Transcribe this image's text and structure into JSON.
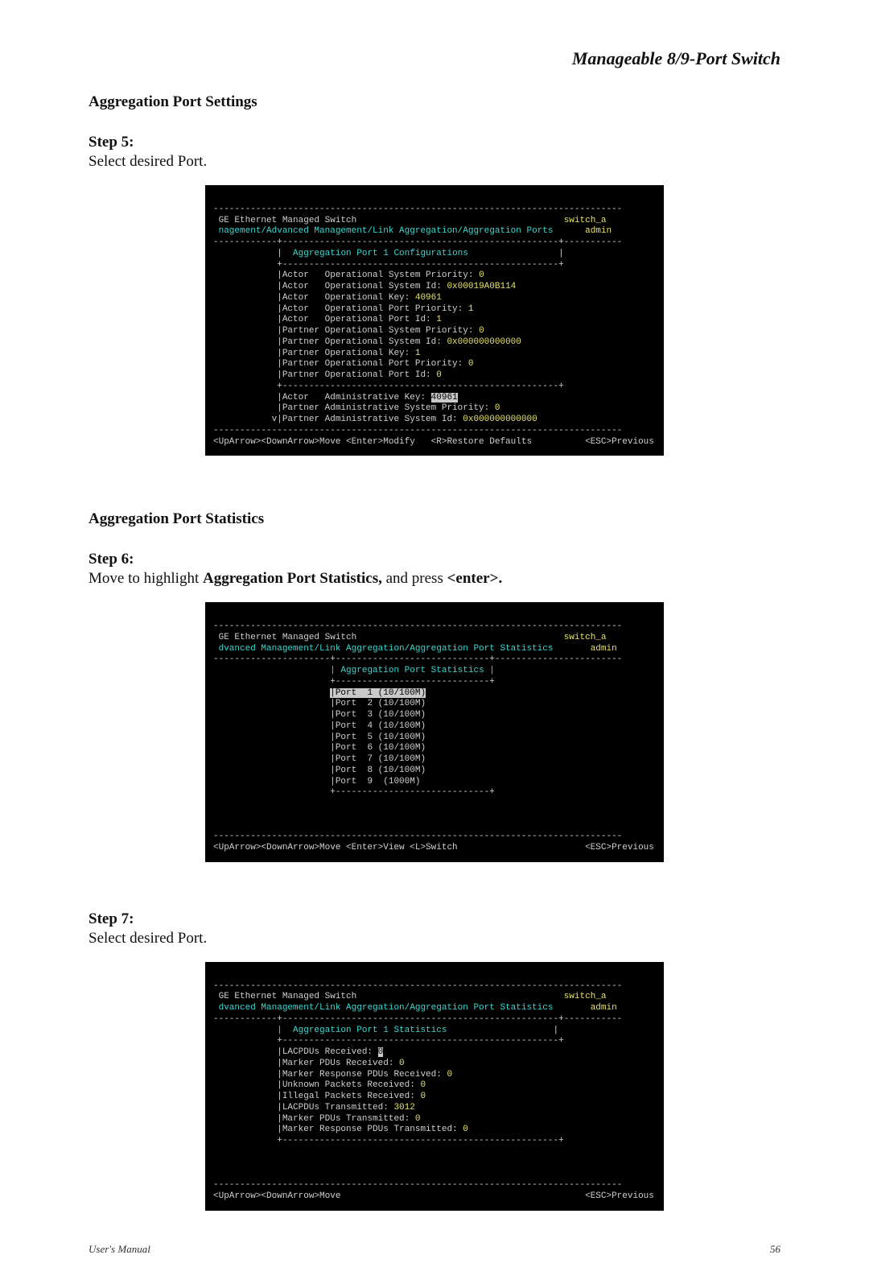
{
  "header": {
    "title": "Manageable 8/9-Port Switch"
  },
  "section1": {
    "title": "Aggregation Port Settings",
    "step_label": "Step 5:",
    "step_body": "Select desired Port."
  },
  "term1": {
    "brand": "GE Ethernet Managed Switch",
    "host": "switch_a",
    "user": "admin",
    "breadcrumb": "nagement/Advanced Management/Link Aggregation/Aggregation Ports",
    "panel_title": "Aggregation Port 1 Configurations",
    "rows": [
      {
        "l": "|Actor   Operational System Priority:",
        "v": " 0"
      },
      {
        "l": "|Actor   Operational System Id:",
        "v": " 0x00019A0B114"
      },
      {
        "l": "|Actor   Operational Key:",
        "v": " 40961"
      },
      {
        "l": "|Actor   Operational Port Priority:",
        "v": " 1"
      },
      {
        "l": "|Actor   Operational Port Id:",
        "v": " 1"
      },
      {
        "l": "|Partner Operational System Priority:",
        "v": " 0"
      },
      {
        "l": "|Partner Operational System Id:",
        "v": " 0x000000000000"
      },
      {
        "l": "|Partner Operational Key:",
        "v": " 1"
      },
      {
        "l": "|Partner Operational Port Priority:",
        "v": " 0"
      },
      {
        "l": "|Partner Operational Port Id:",
        "v": " 0"
      }
    ],
    "adm_actor_l": "|Actor   Administrative Key: ",
    "adm_actor_v": "40961",
    "adm_partner_prio_l": "|Partner Administrative System Priority:",
    "adm_partner_prio_v": " 0",
    "adm_partner_id_l": "v|Partner Administrative System Id:",
    "adm_partner_id_v": " 0x000000000000",
    "help": "<UpArrow><DownArrow>Move <Enter>Modify   <R>Restore Defaults          <ESC>Previous"
  },
  "section2": {
    "title": "Aggregation Port Statistics",
    "step_label": "Step 6:",
    "step_body_pre": "Move to highlight ",
    "step_body_bold1": "Aggregation Port Statistics,",
    "step_body_mid": " and press ",
    "step_body_bold2": "<enter>."
  },
  "term2": {
    "brand": "GE Ethernet Managed Switch",
    "host": "switch_a",
    "user": "admin",
    "breadcrumb": "dvanced Management/Link Aggregation/Aggregation Port Statistics",
    "panel_title": "| Aggregation Port Statistics |",
    "sel": "|Port  1 (10/100M)",
    "ports": [
      "|Port  2 (10/100M)",
      "|Port  3 (10/100M)",
      "|Port  4 (10/100M)",
      "|Port  5 (10/100M)",
      "|Port  6 (10/100M)",
      "|Port  7 (10/100M)",
      "|Port  8 (10/100M)",
      "|Port  9  (1000M)"
    ],
    "help": "<UpArrow><DownArrow>Move <Enter>View <L>Switch                        <ESC>Previous"
  },
  "section3": {
    "step_label": "Step 7:",
    "step_body": "Select desired Port."
  },
  "term3": {
    "brand": "GE Ethernet Managed Switch",
    "host": "switch_a",
    "user": "admin",
    "breadcrumb": "dvanced Management/Link Aggregation/Aggregation Port Statistics",
    "panel_title": "|  Aggregation Port 1 Statistics",
    "stat_sel_l": "|LACPDUs Received: ",
    "stat_sel_v": "0",
    "stats": [
      {
        "l": "|Marker PDUs Received:",
        "v": " 0"
      },
      {
        "l": "|Marker Response PDUs Received:",
        "v": " 0"
      },
      {
        "l": "|Unknown Packets Received:",
        "v": " 0"
      },
      {
        "l": "|Illegal Packets Received:",
        "v": " 0"
      },
      {
        "l": "|LACPDUs Transmitted:",
        "v": " 3012"
      },
      {
        "l": "|Marker PDUs Transmitted:",
        "v": " 0"
      },
      {
        "l": "|Marker Response PDUs Transmitted:",
        "v": " 0"
      }
    ],
    "help": "<UpArrow><DownArrow>Move                                              <ESC>Previous"
  },
  "footer": {
    "left": "User's Manual",
    "right": "56"
  }
}
